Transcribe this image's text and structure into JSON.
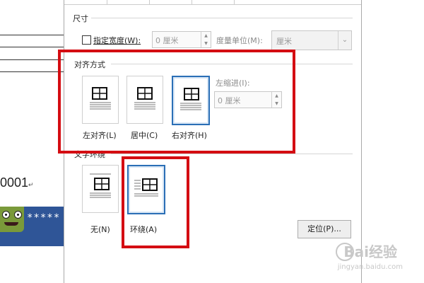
{
  "document": {
    "number_text": "0001",
    "stars_text": "*****"
  },
  "dialog": {
    "size_section": {
      "title": "尺寸",
      "width_checkbox_label": "指定宽度(W):",
      "width_value": "0 厘米",
      "unit_label": "度量单位(M):",
      "unit_value": "厘米"
    },
    "alignment_section": {
      "title": "对齐方式",
      "options": [
        {
          "label": "左对齐(L)"
        },
        {
          "label": "居中(C)"
        },
        {
          "label": "右对齐(H)",
          "selected": true
        }
      ],
      "indent_label": "左缩进(I):",
      "indent_value": "0 厘米"
    },
    "wrap_section": {
      "title": "文字环绕",
      "options": [
        {
          "label": "无(N)"
        },
        {
          "label": "环绕(A)",
          "selected": true
        }
      ],
      "position_button": "定位(P)..."
    }
  },
  "watermark": {
    "text": "Bai经验",
    "url": "jingyan.baidu.com"
  },
  "colors": {
    "highlight": "#d40d12",
    "selected_border": "#2b6fb6",
    "doc_blue": "#2f5597"
  }
}
